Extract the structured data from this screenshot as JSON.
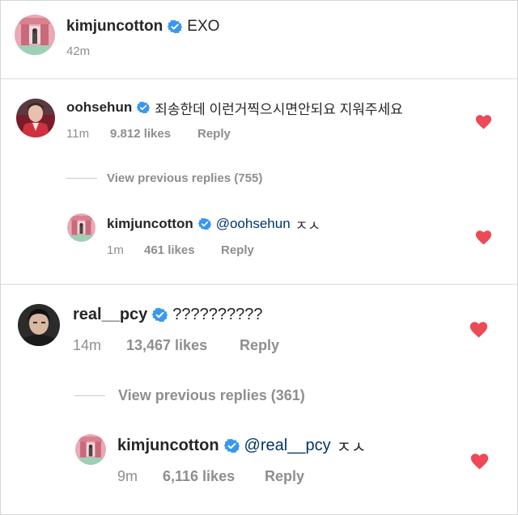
{
  "post": {
    "username": "kimjuncotton",
    "caption": "EXO",
    "time": "42m",
    "avatar_icon": "avatar-pink-room"
  },
  "comments": [
    {
      "username": "oohsehun",
      "text": "죄송한데 이런거찍으시면안되요 지워주세요",
      "time": "11m",
      "likes": "9.812 likes",
      "reply_label": "Reply",
      "liked": true,
      "avatar_icon": "avatar-red-jacket",
      "view_previous": "View previous replies (755)",
      "reply": {
        "username": "kimjuncotton",
        "mention": "@oohsehun",
        "text": "ㅈㅅ",
        "time": "1m",
        "likes": "461 likes",
        "reply_label": "Reply",
        "liked": true,
        "avatar_icon": "avatar-pink-room"
      }
    },
    {
      "username": "real__pcy",
      "text": "??????????",
      "time": "14m",
      "likes": "13,467 likes",
      "reply_label": "Reply",
      "liked": true,
      "avatar_icon": "avatar-dark-portrait",
      "view_previous": "View previous replies (361)",
      "reply": {
        "username": "kimjuncotton",
        "mention": "@real__pcy",
        "text": "ㅈㅅ",
        "time": "9m",
        "likes": "6,116 likes",
        "reply_label": "Reply",
        "liked": true,
        "avatar_icon": "avatar-pink-room"
      }
    }
  ],
  "colors": {
    "verified_badge": "#3897f0",
    "heart": "#ed4956",
    "muted_text": "#8e8e8e",
    "mention": "#003569"
  }
}
